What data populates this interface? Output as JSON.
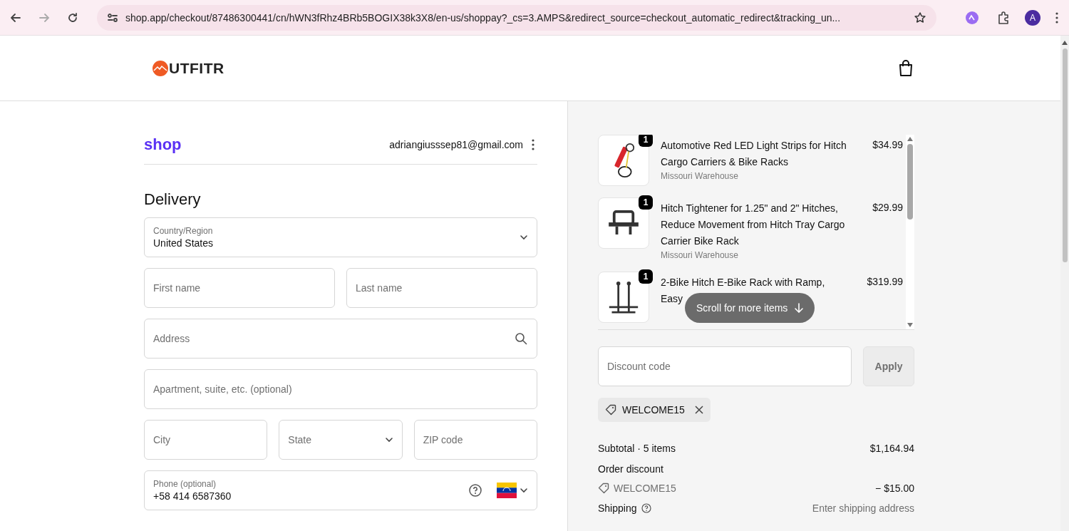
{
  "browser": {
    "url": "shop.app/checkout/87486300441/cn/hWN3fRhz4BRb5BOGIX38k3X8/en-us/shoppay?_cs=3.AMPS&redirect_source=checkout_automatic_redirect&tracking_un...",
    "avatar": "A"
  },
  "header": {
    "logo_text": "UTFITR"
  },
  "account": {
    "brand": "shop",
    "email": "adriangiusssep81@gmail.com"
  },
  "delivery": {
    "heading": "Delivery",
    "rows": [
      [
        {
          "kind": "select",
          "label": "Country/Region",
          "value": "United States"
        }
      ],
      [
        {
          "kind": "text",
          "placeholder": "First name"
        },
        {
          "kind": "text",
          "placeholder": "Last name"
        }
      ],
      [
        {
          "kind": "search",
          "placeholder": "Address"
        }
      ],
      [
        {
          "kind": "text",
          "placeholder": "Apartment, suite, etc. (optional)"
        }
      ],
      [
        {
          "kind": "text",
          "placeholder": "City"
        },
        {
          "kind": "select",
          "placeholder": "State"
        },
        {
          "kind": "text",
          "placeholder": "ZIP code"
        }
      ],
      [
        {
          "kind": "phone",
          "label": "Phone (optional)",
          "value": "+58 414 6587360"
        }
      ]
    ]
  },
  "order": {
    "items": [
      {
        "quantity": "1",
        "title": "Automotive Red LED Light Strips for Hitch Cargo Carriers & Bike Racks",
        "warehouse": "Missouri Warehouse",
        "price": "$34.99",
        "kind": "light"
      },
      {
        "quantity": "1",
        "title": "Hitch Tightener for 1.25\" and 2\" Hitches, Reduce Movement from Hitch Tray Cargo Carrier Bike Rack",
        "warehouse": "Missouri Warehouse",
        "price": "$29.99",
        "kind": "clamp"
      },
      {
        "quantity": "1",
        "title": "2-Bike Hitch E-Bike Rack with Ramp, Easy",
        "price": "$319.99",
        "kind": "rack"
      }
    ],
    "scroll_hint": "Scroll for more items",
    "discount": {
      "placeholder": "Discount code",
      "button": "Apply"
    },
    "applied_codes": [
      "WELCOME15"
    ],
    "summary": {
      "subtotal_label": "Subtotal · 5 items",
      "subtotal": "$1,164.94",
      "discount_label": "Order discount",
      "discount_code": "WELCOME15",
      "discount": "− $15.00",
      "shipping_label": "Shipping",
      "shipping": "Enter shipping address"
    }
  }
}
